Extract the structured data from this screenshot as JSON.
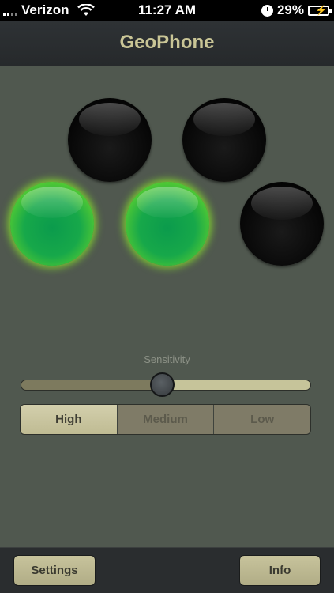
{
  "status_bar": {
    "carrier": "Verizon",
    "time": "11:27 AM",
    "battery": "29%"
  },
  "nav": {
    "title": "GeoPhone"
  },
  "lights": [
    {
      "state": "off"
    },
    {
      "state": "off"
    },
    {
      "state": "on"
    },
    {
      "state": "on"
    },
    {
      "state": "off"
    }
  ],
  "sensitivity": {
    "label": "Sensitivity",
    "slider_value": 0.49,
    "options": [
      "High",
      "Medium",
      "Low"
    ],
    "selected": "High"
  },
  "toolbar": {
    "settings_label": "Settings",
    "info_label": "Info"
  },
  "colors": {
    "light_on": "#5ed12e",
    "accent": "#c9c596",
    "background": "#50584f"
  }
}
